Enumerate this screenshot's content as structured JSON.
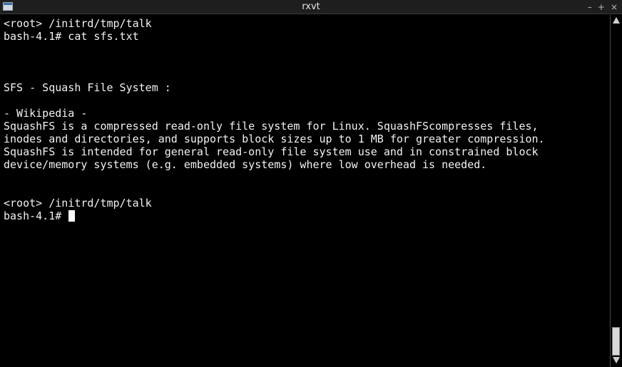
{
  "window": {
    "title": "rxvt",
    "icon": "terminal-window-icon",
    "controls": {
      "minimize": "–",
      "maximize": "+",
      "close": "×"
    }
  },
  "terminal": {
    "lines": [
      "<root> /initrd/tmp/talk",
      "bash-4.1# cat sfs.txt",
      "",
      "",
      "",
      "SFS - Squash File System :",
      "",
      "- Wikipedia -",
      "SquashFS is a compressed read-only file system for Linux. SquashFScompresses files,",
      "inodes and directories, and supports block sizes up to 1 MB for greater compression.",
      "SquashFS is intended for general read-only file system use and in constrained block",
      "device/memory systems (e.g. embedded systems) where low overhead is needed.",
      "",
      "",
      "<root> /initrd/tmp/talk",
      "bash-4.1# "
    ]
  },
  "colors": {
    "background": "#000000",
    "foreground": "#f2f2f2",
    "titlebar": "#1e1e1e"
  }
}
